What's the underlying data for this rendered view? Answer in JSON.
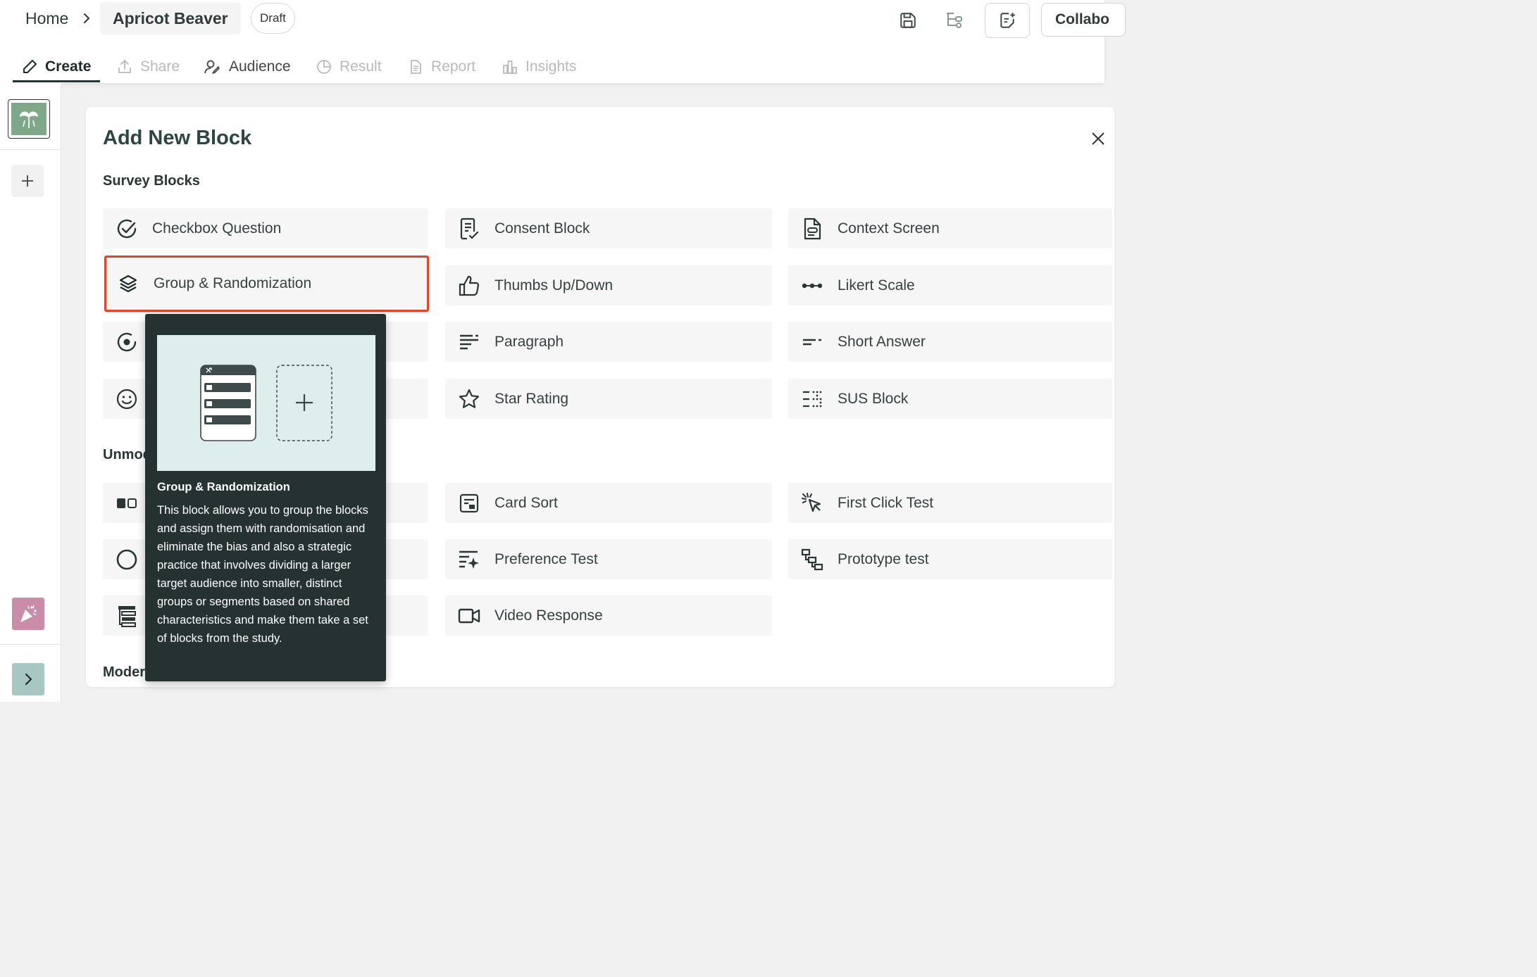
{
  "breadcrumb": {
    "home": "Home",
    "project": "Apricot Beaver",
    "status": "Draft"
  },
  "header": {
    "collab_label": "Collabo"
  },
  "tabs": [
    {
      "label": "Create",
      "icon": "pencil-icon",
      "state": "active"
    },
    {
      "label": "Share",
      "icon": "share-icon",
      "state": "disabled"
    },
    {
      "label": "Audience",
      "icon": "audience-icon",
      "state": "normal"
    },
    {
      "label": "Result",
      "icon": "pie-icon",
      "state": "disabled"
    },
    {
      "label": "Report",
      "icon": "document-icon",
      "state": "disabled"
    },
    {
      "label": "Insights",
      "icon": "bar-chart-icon",
      "state": "disabled"
    }
  ],
  "dialog": {
    "title": "Add New Block",
    "sections": {
      "survey": "Survey Blocks",
      "unmoderated": "Unmod",
      "moderated": "Moder"
    },
    "survey_blocks": [
      "Checkbox Question",
      "Consent Block",
      "Context Screen",
      "Group & Randomization",
      "Thumbs Up/Down",
      "Likert Scale",
      "Paragraph",
      "Short Answer",
      "Star Rating",
      "SUS Block"
    ],
    "unmoderated_blocks": [
      "Card Sort",
      "First Click Test",
      "Preference Test",
      "Prototype test",
      "Video Response"
    ]
  },
  "tooltip": {
    "title": "Group & Randomization",
    "description": "This block allows you to group the blocks and assign them with randomisation and eliminate the bias and also a strategic practice that involves dividing a larger target audience into smaller, distinct groups or segments based on shared characteristics and make them take a set of blocks from the study."
  },
  "colors": {
    "highlight_border": "#e2432a",
    "tooltip_bg": "#263131",
    "tooltip_image_bg": "#deeeed",
    "thumbnail_green": "#7ea889",
    "party_pink": "#c98ca9",
    "expand_teal": "#a9c7c2"
  }
}
